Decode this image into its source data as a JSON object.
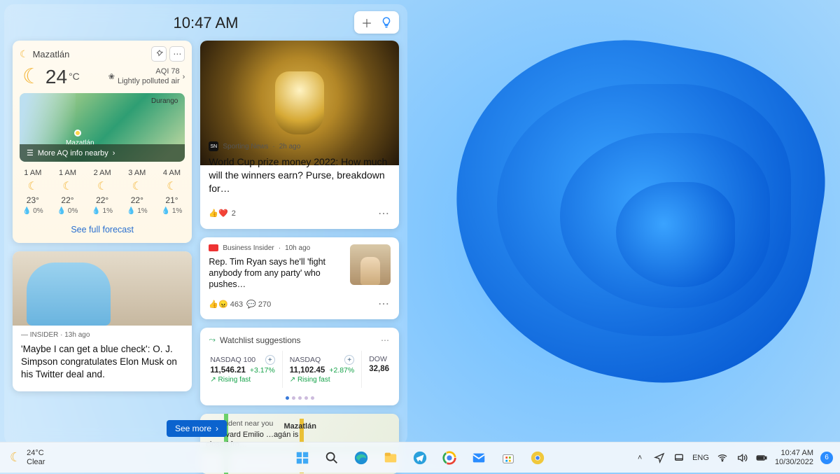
{
  "panel": {
    "time": "10:47 AM"
  },
  "weather": {
    "city": "Mazatlán",
    "temp": "24",
    "unit": "°C",
    "aqi_label": "AQI 78",
    "aqi_desc": "Lightly polluted air",
    "aq_nearby": "More AQ info nearby",
    "map_city": "Mazatlán",
    "map_other": "Durango",
    "forecast_link": "See full forecast",
    "hours": [
      {
        "t": "1 AM",
        "deg": "23°",
        "drop": "0%"
      },
      {
        "t": "1 AM",
        "deg": "22°",
        "drop": "0%"
      },
      {
        "t": "2 AM",
        "deg": "22°",
        "drop": "1%"
      },
      {
        "t": "3 AM",
        "deg": "22°",
        "drop": "1%"
      },
      {
        "t": "4 AM",
        "deg": "21°",
        "drop": "1%"
      }
    ]
  },
  "news1": {
    "source": "Sporting News",
    "ago": "2h ago",
    "headline": "World Cup prize money 2022: How much will the winners earn? Purse, breakdown for…",
    "reactions": "2"
  },
  "news2": {
    "source": "Business Insider",
    "ago": "10h ago",
    "headline": "Rep. Tim Ryan says he'll 'fight anybody from any party' who pushes…",
    "likes": "463",
    "comments": "270"
  },
  "watch": {
    "title": "Watchlist suggestions",
    "items": [
      {
        "sym": "NASDAQ 100",
        "val": "11,546.21",
        "chg": "+3.17%",
        "note": "Rising fast"
      },
      {
        "sym": "NASDAQ",
        "val": "11,102.45",
        "chg": "+2.87%",
        "note": "Rising fast"
      },
      {
        "sym": "DOW",
        "val": "32,86",
        "chg": "",
        "note": ""
      }
    ]
  },
  "incident": {
    "title": "Incident near you",
    "text": "Boulevard Emilio …agán is closed fro…",
    "city": "Mazatlán"
  },
  "story": {
    "source": "INSIDER",
    "ago": "13h ago",
    "headline": "'Maybe I can get a blue check': O. J. Simpson congratulates Elon Musk on his Twitter deal and."
  },
  "see_more": "See more",
  "taskbar": {
    "temp": "24°C",
    "cond": "Clear",
    "lang": "ENG",
    "time": "10:47 AM",
    "date": "10/30/2022",
    "notif": "6"
  }
}
